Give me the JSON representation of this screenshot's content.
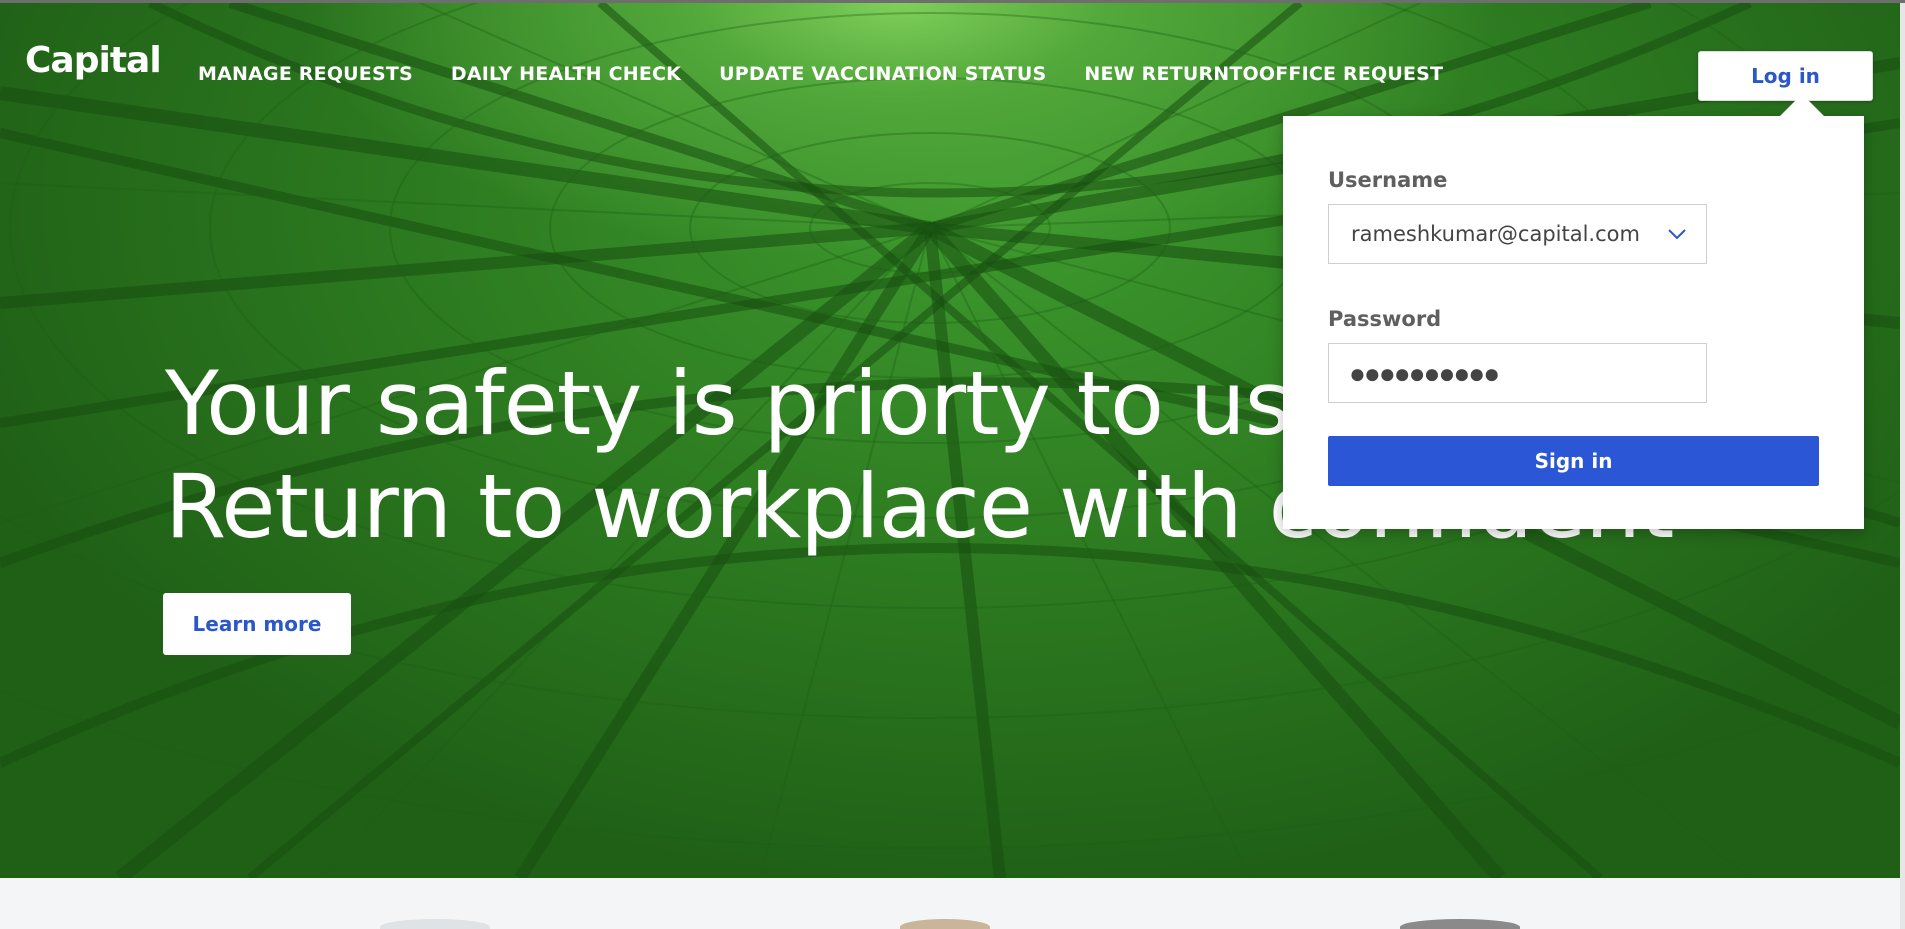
{
  "brand": {
    "logo_text": "Capital"
  },
  "nav": {
    "items": [
      "MANAGE REQUESTS",
      "DAILY HEALTH CHECK",
      "UPDATE VACCINATION STATUS",
      "NEW RETURNTOOFFICE REQUEST"
    ]
  },
  "header": {
    "login_label": "Log in"
  },
  "login_popup": {
    "username_label": "Username",
    "username_value": "rameshkumar@capital.com",
    "password_label": "Password",
    "password_mask": "●●●●●●●●●●",
    "signin_label": "Sign in"
  },
  "hero": {
    "headline_line1": "Your safety is priorty to us,",
    "headline_line2": "Return to workplace with confident",
    "learn_more_label": "Learn more"
  },
  "colors": {
    "accent_blue": "#2b57d6",
    "hero_green": "#2f7f22",
    "text_white": "#ffffff"
  },
  "icons": {
    "username_dropdown": "chevron-down-icon"
  }
}
